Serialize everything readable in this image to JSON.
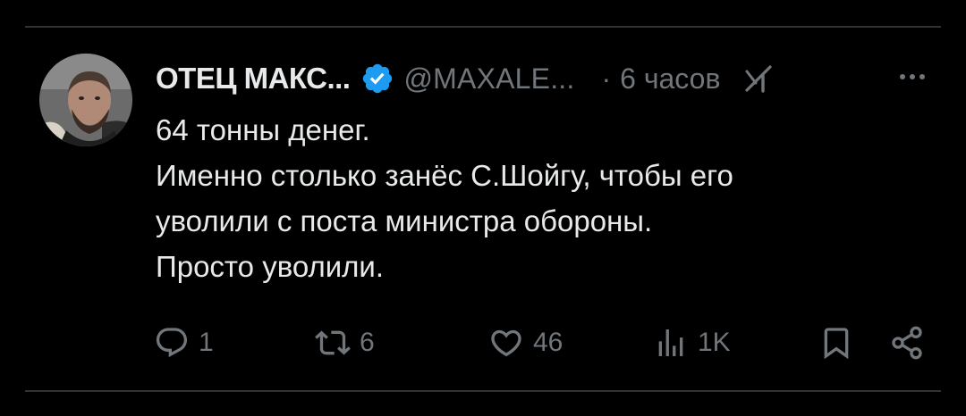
{
  "author": {
    "display_name": "ОТЕЦ МАКС...",
    "handle": "@MAXALE...",
    "separator": "·",
    "time": "6 часов",
    "verified": true,
    "verified_color": "#1d9bf0"
  },
  "tweet": {
    "lines": [
      "64 тонны денег.",
      "Именно столько занёс С.Шойгу, чтобы его",
      "уволили с поста министра обороны.",
      "Просто уволили."
    ]
  },
  "actions": {
    "replies": "1",
    "retweets": "6",
    "likes": "46",
    "views": "1K"
  },
  "icons": {
    "verified": "verified-badge-icon",
    "grok": "grok-icon",
    "more": "more-options-icon",
    "reply": "reply-icon",
    "retweet": "retweet-icon",
    "like": "heart-icon",
    "views": "views-chart-icon",
    "bookmark": "bookmark-icon",
    "share": "share-icon"
  },
  "colors": {
    "background": "#000000",
    "text": "#e7e9ea",
    "muted": "#71767b",
    "divider": "#2f3336"
  }
}
